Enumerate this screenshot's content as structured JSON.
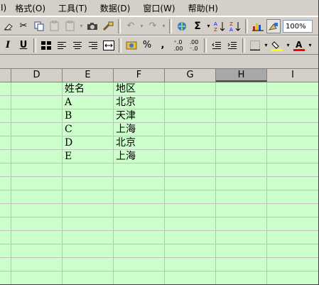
{
  "menu": [
    "I)",
    "格式(O)",
    "工具(T)",
    "数据(D)",
    "窗口(W)",
    "帮助(H)"
  ],
  "toolbar1": {
    "icons": [
      "eraser-icon",
      "cut-icon",
      "copy-icon",
      "paste-icon",
      "paste-dropdown-icon",
      "camera-icon",
      "format-painter-icon",
      "undo-icon",
      "undo-dropdown-icon",
      "redo-icon",
      "redo-dropdown-icon",
      "hyperlink-icon",
      "autosum-icon",
      "autosum-dropdown-icon",
      "sort-ascending-icon",
      "sort-descending-icon",
      "chart-wizard-icon",
      "drawing-icon"
    ],
    "zoom": "100%"
  },
  "toolbar2": {
    "icons": [
      "italic-icon",
      "underline-icon",
      "merge-cells-icon",
      "align-left-icon",
      "align-center-icon",
      "align-right-icon",
      "merge-center-icon",
      "currency-icon",
      "percent-icon",
      "comma-icon",
      "increase-decimal-icon",
      "decrease-decimal-icon",
      "decrease-indent-icon",
      "increase-indent-icon",
      "borders-icon",
      "borders-dropdown-icon",
      "fill-color-icon",
      "fill-color-dropdown-icon",
      "font-color-icon",
      "font-color-dropdown-icon"
    ]
  },
  "columns": [
    "D",
    "E",
    "F",
    "G",
    "H",
    "I"
  ],
  "selected_column": "H",
  "cells": {
    "E": [
      "姓名",
      "A",
      "B",
      "C",
      "D",
      "E"
    ],
    "F": [
      "地区",
      "北京",
      "天津",
      "上海",
      "北京",
      "上海"
    ]
  },
  "colors": {
    "cell_background": "#ccffcc",
    "chrome": "#d4d0c8",
    "gridline": "#c0c0c0",
    "font_color_bar": "#ff0000",
    "fill_color_bar": "#ffff00"
  }
}
